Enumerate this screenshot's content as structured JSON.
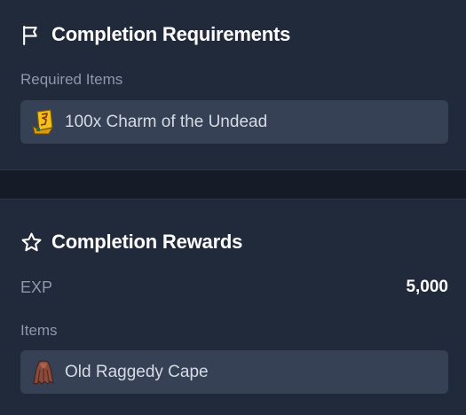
{
  "requirements": {
    "title": "Completion Requirements",
    "header_icon": "flag-icon",
    "section_label": "Required Items",
    "items": [
      {
        "name": "100x Charm of the Undead",
        "icon": "charm-of-the-undead-icon"
      }
    ]
  },
  "rewards": {
    "title": "Completion Rewards",
    "header_icon": "star-icon",
    "exp_label": "EXP",
    "exp_value": "5,000",
    "items_label": "Items",
    "items": [
      {
        "name": "Old Raggedy Cape",
        "icon": "raggedy-cape-icon"
      }
    ]
  },
  "colors": {
    "background": "#151c28",
    "card": "#212a3b",
    "item_box": "#364155",
    "label": "#8e98aa",
    "title": "#ffffff"
  }
}
